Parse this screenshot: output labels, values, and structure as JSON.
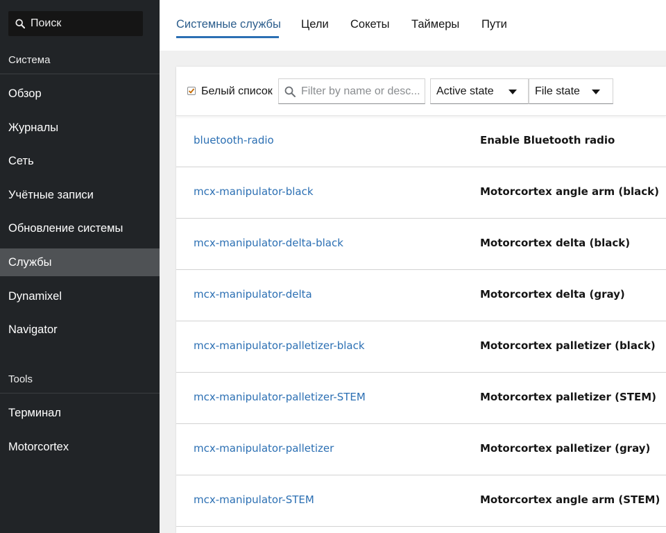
{
  "sidebar": {
    "search_label": "Поиск",
    "sections": [
      {
        "title": "Система"
      },
      {
        "title": "Tools"
      }
    ],
    "items": [
      {
        "label": "Обзор"
      },
      {
        "label": "Журналы"
      },
      {
        "label": "Сеть"
      },
      {
        "label": "Учётные записи"
      },
      {
        "label": "Обновление системы"
      },
      {
        "label": "Службы",
        "active": true
      },
      {
        "label": "Dynamixel"
      },
      {
        "label": "Navigator"
      },
      {
        "label": "Терминал"
      },
      {
        "label": "Motorcortex"
      }
    ]
  },
  "tabs": [
    {
      "label": "Системные службы",
      "active": true
    },
    {
      "label": "Цели"
    },
    {
      "label": "Сокеты"
    },
    {
      "label": "Таймеры"
    },
    {
      "label": "Пути"
    }
  ],
  "toolbar": {
    "whitelist_label": "Белый список",
    "whitelist_checked": true,
    "filter_placeholder": "Filter by name or desc...",
    "active_state_label": "Active state",
    "file_state_label": "File state"
  },
  "services": [
    {
      "name": "bluetooth-radio",
      "description": "Enable Bluetooth radio"
    },
    {
      "name": "mcx-manipulator-black",
      "description": "Motorcortex angle arm (black)"
    },
    {
      "name": "mcx-manipulator-delta-black",
      "description": "Motorcortex delta (black)"
    },
    {
      "name": "mcx-manipulator-delta",
      "description": "Motorcortex delta (gray)"
    },
    {
      "name": "mcx-manipulator-palletizer-black",
      "description": "Motorcortex palletizer (black)"
    },
    {
      "name": "mcx-manipulator-palletizer-STEM",
      "description": "Motorcortex palletizer (STEM)"
    },
    {
      "name": "mcx-manipulator-palletizer",
      "description": "Motorcortex palletizer (gray)"
    },
    {
      "name": "mcx-manipulator-STEM",
      "description": "Motorcortex angle arm (STEM)"
    }
  ],
  "colors": {
    "sidebar_bg": "#212427",
    "active_item_bg": "#4f5255",
    "link": "#2b6fb3",
    "tab_active": "#2b5d8c"
  }
}
